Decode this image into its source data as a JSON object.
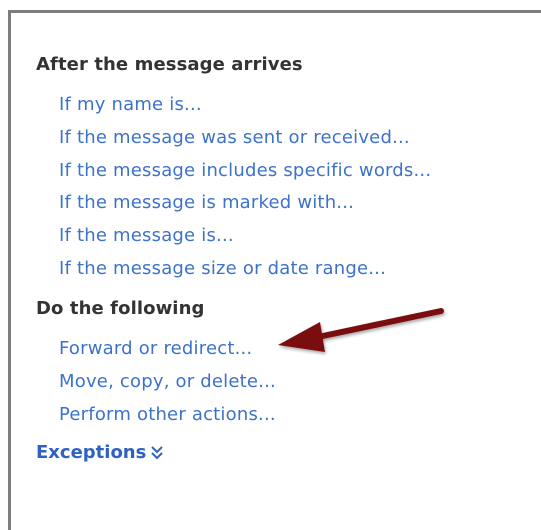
{
  "after_section": {
    "heading": "After the message arrives",
    "items": [
      {
        "label": "If my name is..."
      },
      {
        "label": "If the message was sent or received..."
      },
      {
        "label": "If the message includes specific words..."
      },
      {
        "label": "If the message is marked with..."
      },
      {
        "label": "If the message is..."
      },
      {
        "label": "If the message size or date range..."
      }
    ]
  },
  "do_section": {
    "heading": "Do the following",
    "items": [
      {
        "label": "Forward or redirect..."
      },
      {
        "label": "Move, copy, or delete..."
      },
      {
        "label": "Perform other actions..."
      }
    ]
  },
  "exceptions": {
    "label": "Exceptions",
    "icon": "double-chevron-down-icon"
  },
  "annotation": {
    "arrow_color": "#7a1010",
    "points_to": "Forward or redirect..."
  },
  "colors": {
    "link": "#3c72c9",
    "heading": "#333333",
    "exceptions": "#2f62c0",
    "border": "#7d7d7d"
  }
}
